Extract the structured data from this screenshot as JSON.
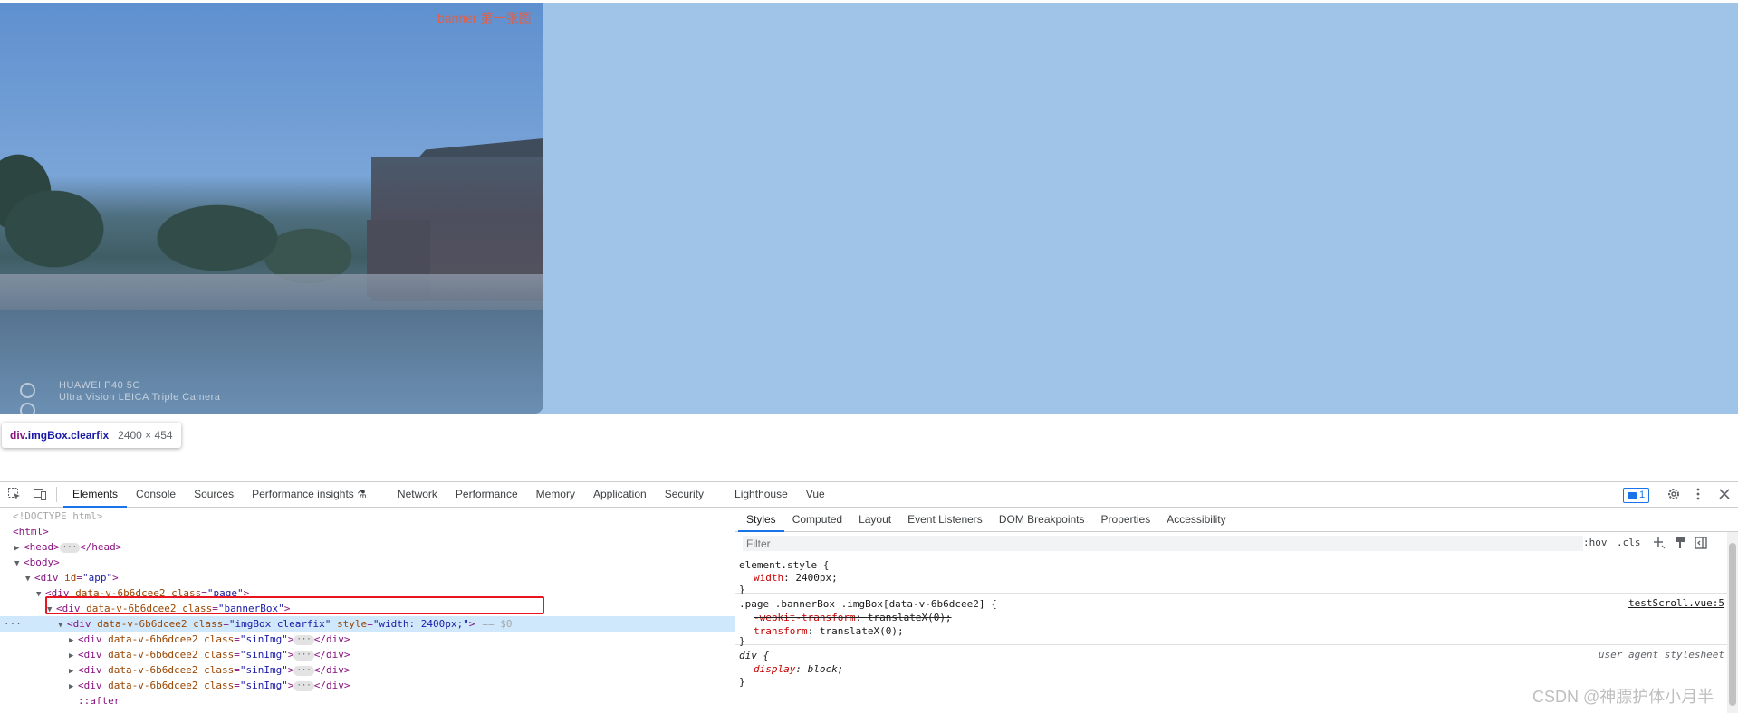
{
  "viewport": {
    "banner_label": "banner 第一张图",
    "camera_line1": "HUAWEI P40 5G",
    "camera_line2": "Ultra Vision LEICA Triple Camera",
    "tooltip": {
      "tag": "div",
      "classes": ".imgBox.clearfix",
      "dims": "2400 × 454"
    },
    "highlight_color": "#a0c4e8"
  },
  "devtools": {
    "tabs": [
      "Elements",
      "Console",
      "Sources",
      "Performance insights ⚗",
      "Network",
      "Performance",
      "Memory",
      "Application",
      "Security",
      "Lighthouse",
      "Vue"
    ],
    "active_tab": "Elements",
    "issues_count": "1",
    "dom": {
      "doctype": "<!DOCTYPE html>",
      "html_open": "<html>",
      "head_open": "<head>",
      "head_close": "</head>",
      "body_open": "<body>",
      "app_tag": "div",
      "app_attr": "id",
      "app_val": "\"app\"",
      "page_tag": "div",
      "page_attr1": "data-v-6b6dcee2",
      "page_attr2": "class",
      "page_val": "\"page\"",
      "bannerbox_val": "\"bannerBox\"",
      "imgbox_val": "\"imgBox clearfix\"",
      "style_attr": "style",
      "style_val": "\"width: 2400px;\"",
      "eq_marker": "== $0",
      "sinimg_val": "\"sinImg\"",
      "div_close": "</div>",
      "after": "::after"
    },
    "styles_tabs": [
      "Styles",
      "Computed",
      "Layout",
      "Event Listeners",
      "DOM Breakpoints",
      "Properties",
      "Accessibility"
    ],
    "filter_placeholder": "Filter",
    "hov": ":hov",
    "cls": ".cls",
    "rules": {
      "element_style": {
        "selector": "element.style {",
        "prop": "width",
        "value": "2400px;"
      },
      "page_rule": {
        "selector": ".page .bannerBox .imgBox[data-v-6b6dcee2] {",
        "source": "testScroll.vue:5",
        "prop1": "-webkit-transform",
        "value1": "translateX(0);",
        "prop2": "transform",
        "value2": "translateX(0);"
      },
      "ua_rule": {
        "selector": "div {",
        "source": "user agent stylesheet",
        "prop": "display",
        "value": "block;"
      },
      "close": "}"
    }
  },
  "watermark": "CSDN @神膘护体小月半"
}
